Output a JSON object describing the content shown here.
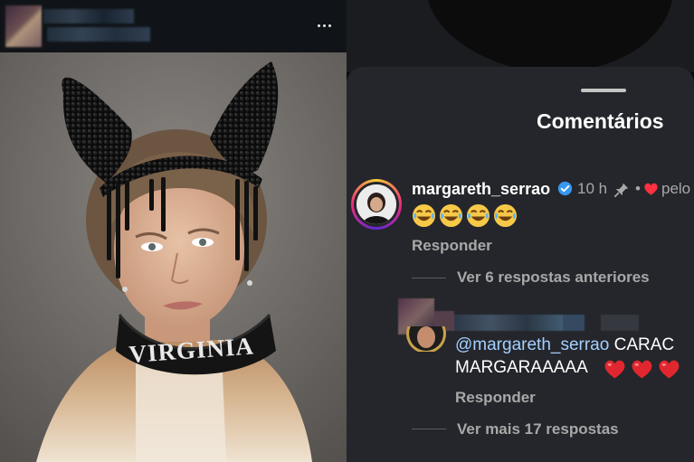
{
  "sheet": {
    "title": "Comentários"
  },
  "comment": {
    "username": "margareth_serrao",
    "time": "10 h",
    "separator": "•",
    "liked_by_author": "pelo",
    "emojis": [
      "😂",
      "😂",
      "😂",
      "😂"
    ],
    "reply_label": "Responder",
    "view_previous": "Ver 6 respostas anteriores"
  },
  "reply": {
    "mention": "@margareth_serrao",
    "text_line1_rest": " CARAC",
    "text_line2": "MARGARAAAAA",
    "hearts": [
      "❤️",
      "❤️",
      "❤️"
    ],
    "reply_label": "Responder",
    "view_more": "Ver mais 17 respostas"
  },
  "post": {
    "collar_text": "VIRGINIA"
  },
  "icons": {
    "more": "more-options-icon",
    "verified": "verified-badge-icon",
    "pin": "pin-icon",
    "heart": "heart-icon"
  },
  "colors": {
    "sheet_bg": "#24262b",
    "muted_text": "#a8a8a8",
    "verified_blue": "#3897f0",
    "heart_red": "#ff3040",
    "mention_blue": "#a4cfff"
  }
}
